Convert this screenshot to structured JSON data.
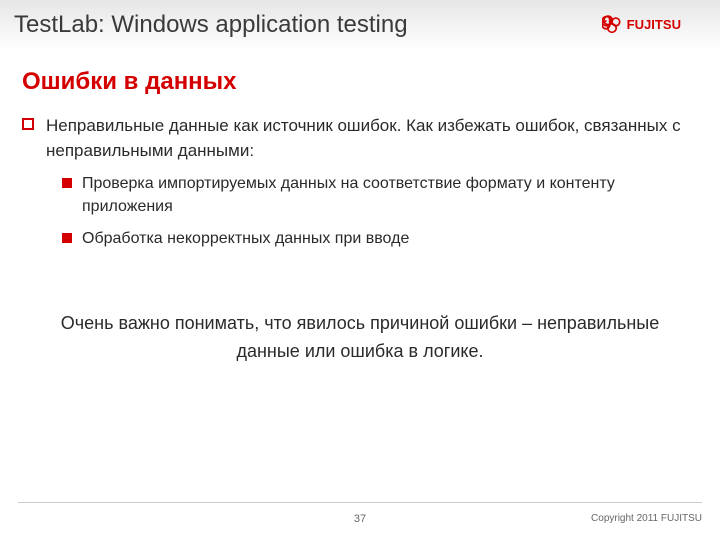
{
  "header": {
    "title": "TestLab: Windows application testing",
    "logo_text": "FUJITSU",
    "logo_color": "#d40000"
  },
  "section": {
    "title": "Ошибки в данных"
  },
  "bullets": {
    "l1_intro": "Неправильные данные как источник ошибок. Как избежать ошибок, связанных с неправильными данными:",
    "l2_a": "Проверка импортируемых данных на соответствие формату и контенту приложения",
    "l2_b": "Обработка некорректных данных при вводе"
  },
  "summary": "Очень важно понимать, что явилось причиной ошибки – неправильные данные или ошибка в логике.",
  "footer": {
    "page": "37",
    "copyright": "Copyright 2011 FUJITSU"
  }
}
